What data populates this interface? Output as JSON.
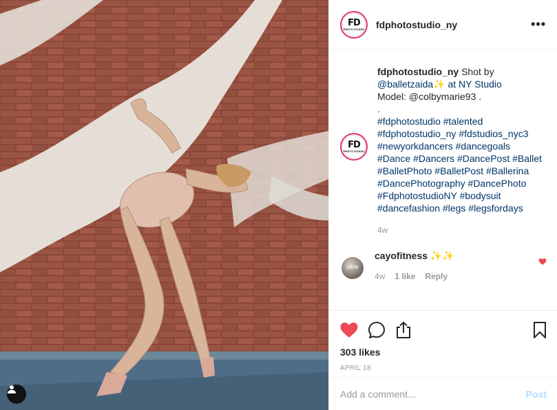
{
  "post": {
    "username": "fdphotostudio_ny",
    "avatar_text": "FD",
    "avatar_subtext": "PHOTO STUDIO",
    "more_icon": "more-horizontal-icon"
  },
  "caption": {
    "username": "fdphotostudio_ny",
    "lines": [
      " Shot by",
      "@balletzaida✨ at NY Studio",
      "Model: @colbymarie93 .",
      ".",
      "#fdphotostudio #talented",
      "#fdphotostudio_ny #fdstudios_nyc3",
      "#newyorkdancers #dancegoals",
      "#Dance #Dancers #DancePost #Ballet",
      "#BalletPhoto #BalletPost #Ballerina",
      "#DancePhotography #DancePhoto",
      "#FdphotostudioNY #bodysuit",
      "#dancefashion #legs #legsfordays"
    ],
    "time": "4w"
  },
  "comment": {
    "username": "cayofitness",
    "text": " ✨✨",
    "avatar_text": "CAYO",
    "time": "4w",
    "likes": "1 like",
    "reply": "Reply"
  },
  "actions": {
    "likes": "303 likes",
    "date": "APRIL 18",
    "like_color": "#ed4956"
  },
  "add_comment": {
    "placeholder": "Add a comment...",
    "post_label": "Post"
  }
}
